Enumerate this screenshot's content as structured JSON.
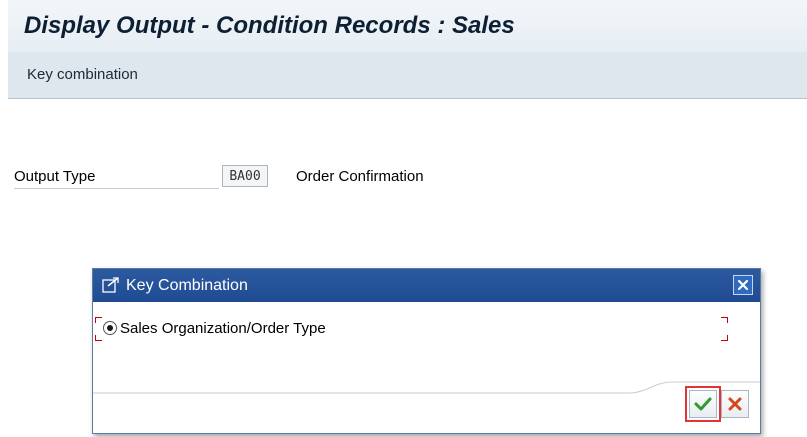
{
  "window": {
    "title": "Display Output - Condition Records : Sales"
  },
  "toolbar": {
    "key_combination_label": "Key combination"
  },
  "form": {
    "output_type_label": "Output Type",
    "output_type_value": "BA00",
    "output_type_description": "Order Confirmation"
  },
  "dialog": {
    "title": "Key Combination",
    "options": [
      {
        "label": "Sales Organization/Order Type",
        "selected": true
      }
    ],
    "ok_icon": "checkmark-icon",
    "cancel_icon": "cancel-x-icon",
    "close_icon": "close-icon"
  },
  "colors": {
    "dialog_header": "#2c5aa0",
    "ok_green": "#2f9a2f",
    "cancel_red": "#d6471b",
    "highlight_red": "#e0333a"
  }
}
